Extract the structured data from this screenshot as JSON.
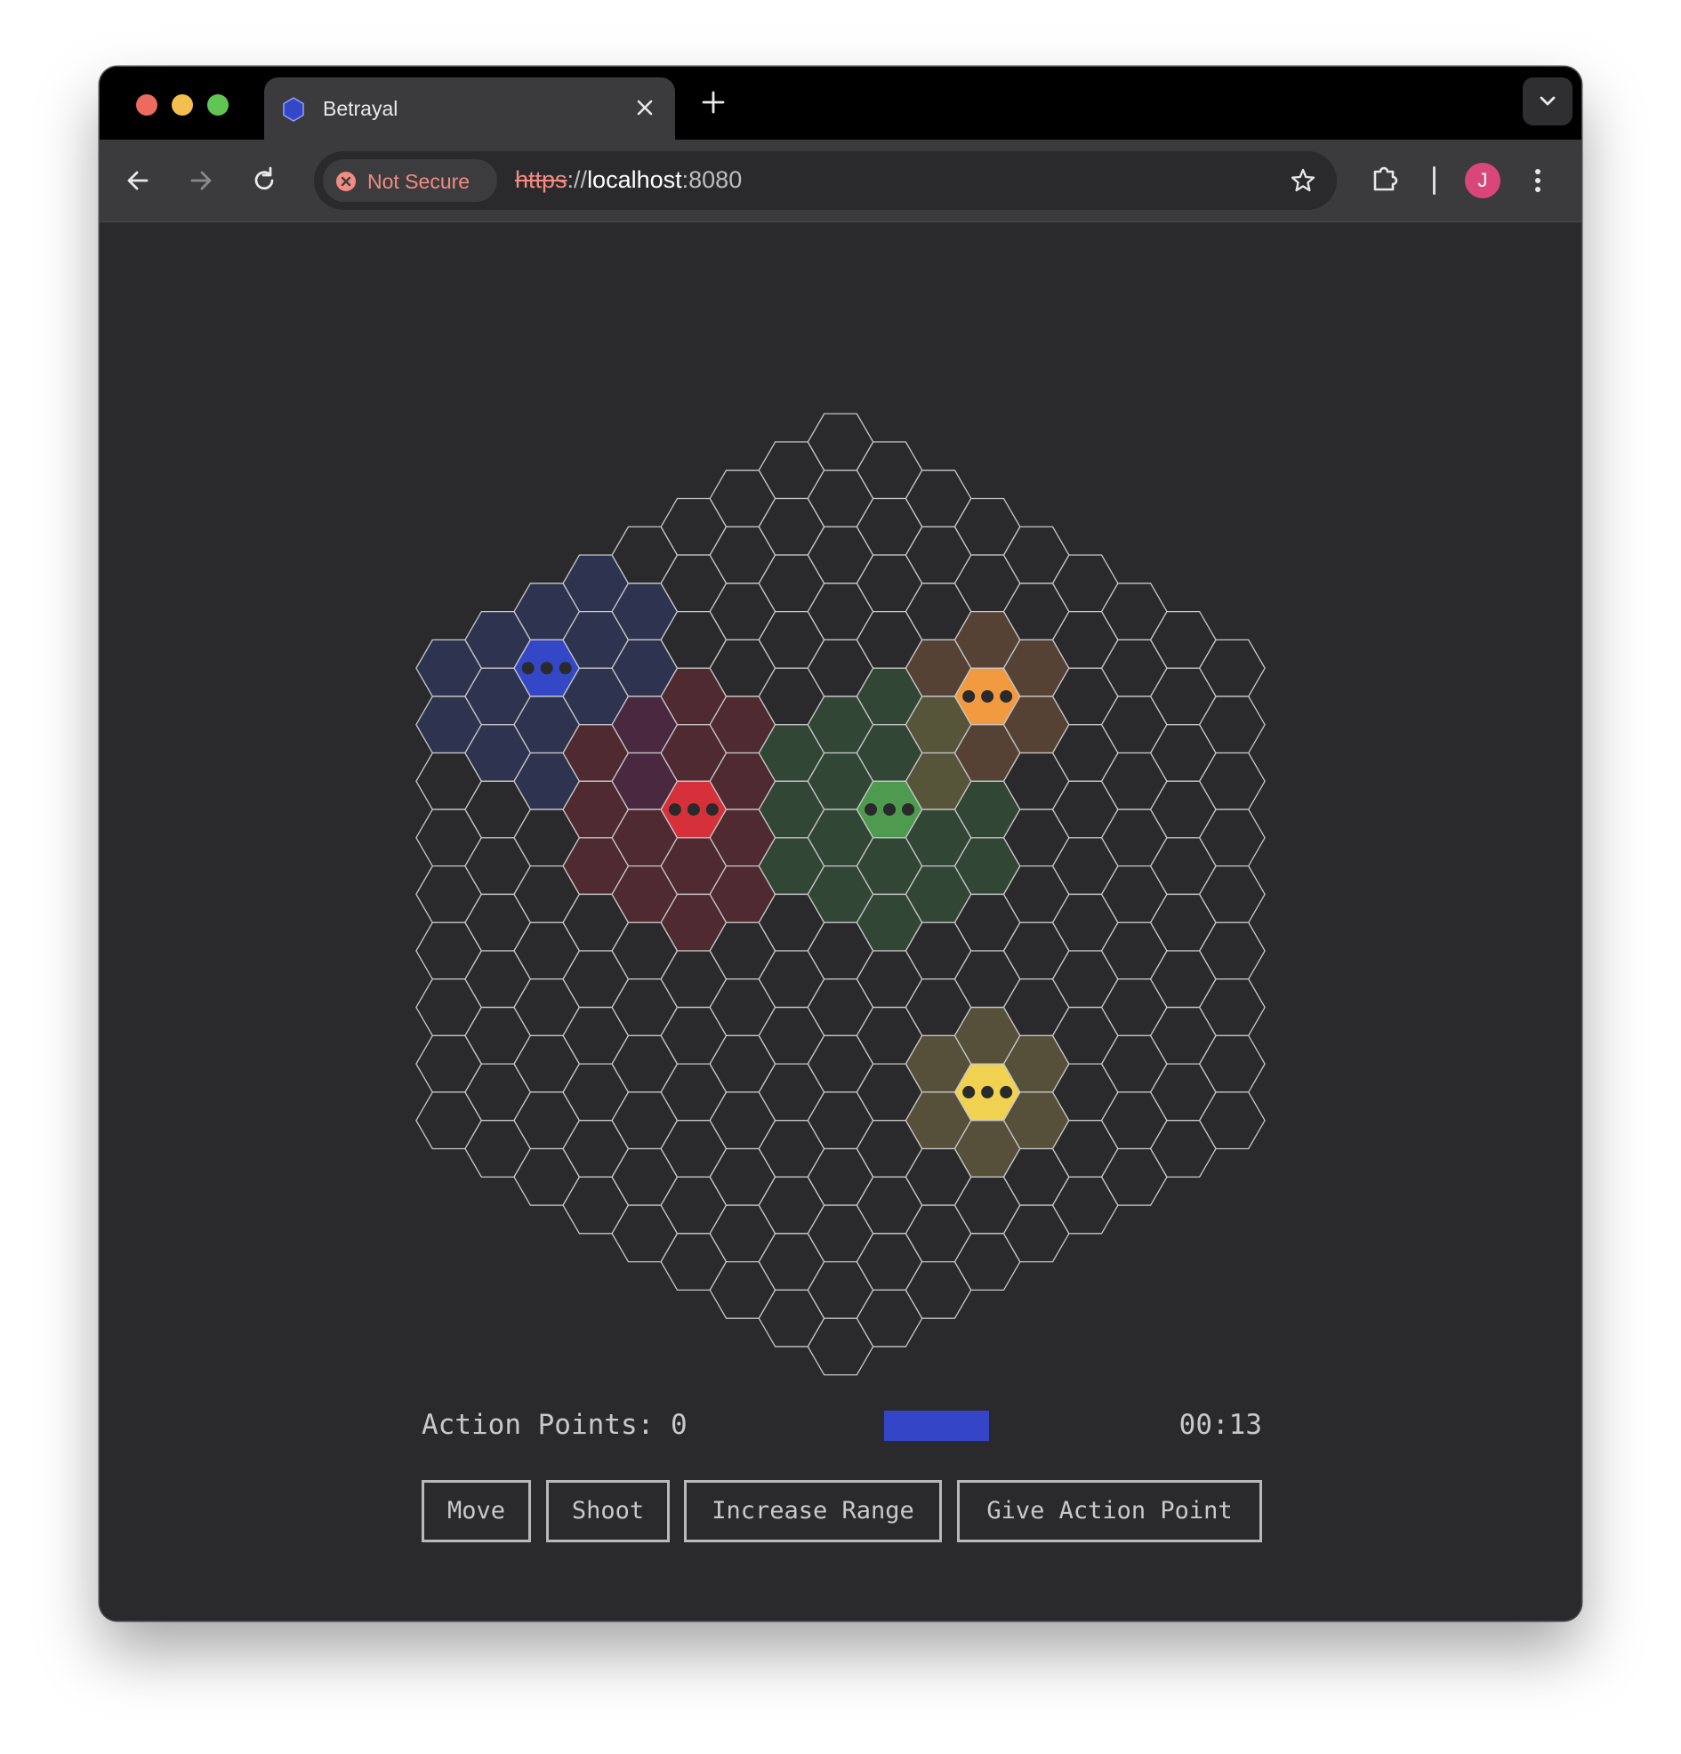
{
  "browser": {
    "tab_title": "Betrayal",
    "security_label": "Not Secure",
    "url_scheme": "https",
    "url_separator": "://",
    "url_host": "localhost",
    "url_port": ":8080",
    "profile_initial": "J"
  },
  "game": {
    "action_points_label": "Action Points: 0",
    "action_points": 0,
    "timer": "00:13",
    "current_player_color": "#3445c8",
    "actions": {
      "move": "Move",
      "shoot": "Shoot",
      "increase_range": "Increase Range",
      "give_action_point": "Give Action Point"
    },
    "board": {
      "radius": 8,
      "colors": {
        "empty_fill": "#2a2a2c",
        "grid_stroke": "#c8c8c8",
        "player_dot": "#2a2a2c"
      },
      "players": [
        {
          "name": "blue",
          "color": "#3447c6",
          "tint": "#2e3450",
          "cell": [
            -6,
            -1
          ],
          "range": 2
        },
        {
          "name": "red",
          "color": "#d6313a",
          "tint": "#4f2a30",
          "cell": [
            -3,
            0
          ],
          "range": 2
        },
        {
          "name": "green",
          "color": "#4e9a4e",
          "tint": "#324636",
          "cell": [
            1,
            -2
          ],
          "range": 2
        },
        {
          "name": "orange",
          "color": "#f29a3f",
          "tint": "#554234",
          "cell": [
            3,
            -5
          ],
          "range": 1
        },
        {
          "name": "yellow",
          "color": "#f0d150",
          "tint": "#56503a",
          "cell": [
            3,
            2
          ],
          "range": 1
        }
      ],
      "overlap_cells": [
        {
          "cell": [
            -4,
            -1
          ],
          "tint": "#4a2840"
        },
        {
          "cell": [
            -4,
            0
          ],
          "tint": "#4a2840"
        },
        {
          "cell": [
            2,
            -4
          ],
          "tint": "#56553a"
        },
        {
          "cell": [
            2,
            -3
          ],
          "tint": "#56553a"
        }
      ]
    }
  }
}
